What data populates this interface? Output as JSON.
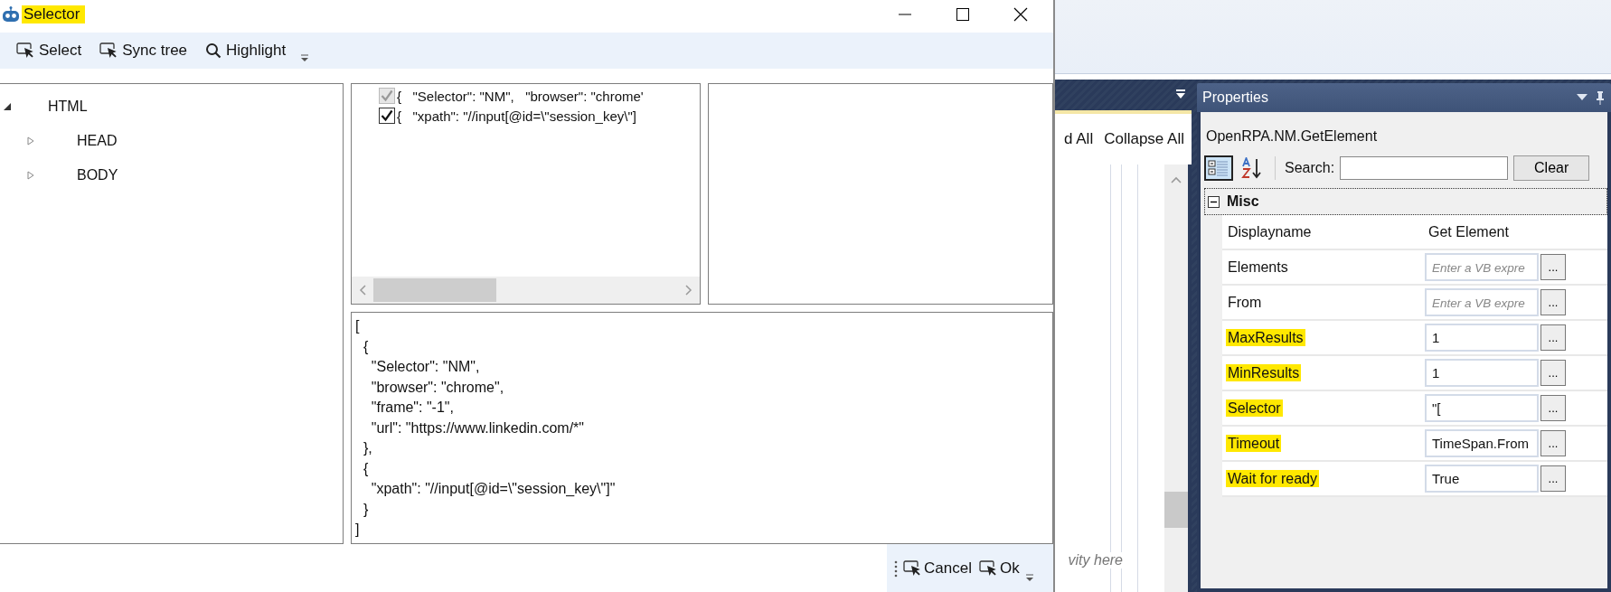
{
  "background_app": {
    "designer": {
      "buttons": [
        "d All",
        "Collapse All"
      ],
      "hint": "vity here"
    },
    "properties": {
      "title": "Properties",
      "activity": "OpenRPA.NM.GetElement",
      "view_buttons": [
        {
          "kind": "categorized",
          "selected": true
        },
        {
          "kind": "alphabetical",
          "selected": false
        }
      ],
      "search_label": "Search:",
      "clear_button": "Clear",
      "category": "Misc",
      "category_expanded": true,
      "rows": [
        {
          "name": "Displayname",
          "kind": "text",
          "value": "Get Element",
          "highlighted": false
        },
        {
          "name": "Elements",
          "kind": "expression",
          "placeholder": "Enter a VB expre",
          "button": "...",
          "highlighted": false
        },
        {
          "name": "From",
          "kind": "expression",
          "placeholder": "Enter a VB expre",
          "button": "...",
          "highlighted": false
        },
        {
          "name": "MaxResults",
          "kind": "expression",
          "value": "1",
          "button": "...",
          "highlighted": true
        },
        {
          "name": "MinResults",
          "kind": "expression",
          "value": "1",
          "button": "...",
          "highlighted": true
        },
        {
          "name": "Selector",
          "kind": "expression",
          "value": "\"[",
          "button": "...",
          "highlighted": true
        },
        {
          "name": "Timeout",
          "kind": "expression",
          "value": "TimeSpan.From",
          "button": "...",
          "highlighted": true
        },
        {
          "name": "Wait for ready",
          "kind": "expression",
          "value": "True",
          "button": "...",
          "highlighted": true
        }
      ]
    }
  },
  "selector_window": {
    "title": "Selector",
    "title_highlighted": true,
    "toolbar": [
      {
        "label": "Select",
        "kind": "pick"
      },
      {
        "label": "Sync tree",
        "kind": "pick"
      },
      {
        "label": "Highlight",
        "kind": "find"
      }
    ],
    "tree": [
      {
        "label": "HTML",
        "expanded": true,
        "children": [
          {
            "label": "HEAD",
            "expanded": false
          },
          {
            "label": "BODY",
            "expanded": false
          }
        ]
      }
    ],
    "selector_items": [
      {
        "text": "{   \"Selector\": \"NM\",   \"browser\": \"chrome'",
        "checked": true,
        "disabled": true
      },
      {
        "text": "{   \"xpath\": \"//input[@id=\\\"session_key\\\"]",
        "checked": true,
        "disabled": false
      }
    ],
    "json_lines": [
      "[",
      "  {",
      "    \"Selector\": \"NM\",",
      "    \"browser\": \"chrome\",",
      "    \"frame\": \"-1\",",
      "    \"url\": \"https://www.linkedin.com/*\"",
      "  },",
      "  {",
      "    \"xpath\": \"//input[@id=\\\"session_key\\\"]\"",
      "  }",
      "]"
    ],
    "buttons": [
      {
        "label": "Cancel"
      },
      {
        "label": "Ok"
      }
    ]
  }
}
